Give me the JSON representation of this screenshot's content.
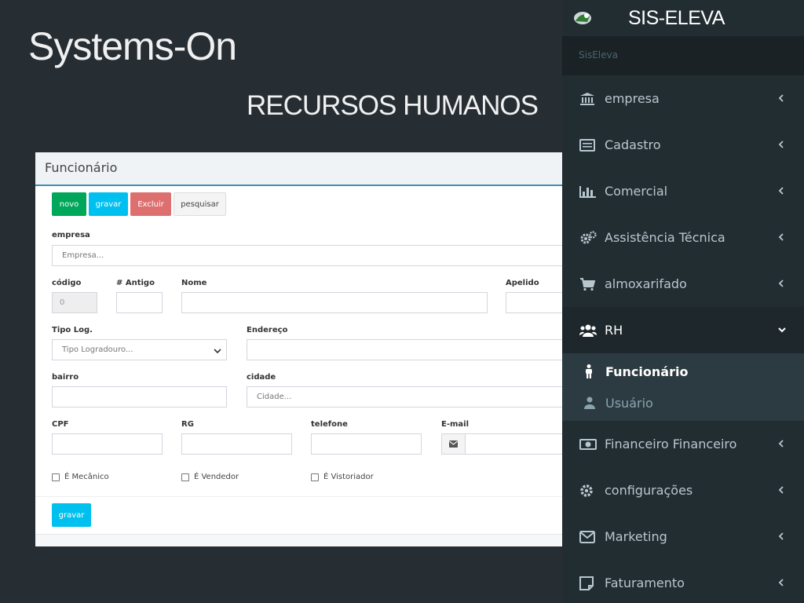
{
  "slide": {
    "title": "Systems-On",
    "subtitle": "RECURSOS HUMANOS"
  },
  "form": {
    "header": "Funcionário",
    "buttons": {
      "novo": "novo",
      "gravar": "gravar",
      "excluir": "Excluir",
      "pesquisar": "pesquisar"
    },
    "fields": {
      "empresa": {
        "label": "empresa",
        "placeholder": "Empresa..."
      },
      "codigo": {
        "label": "código",
        "value": "0"
      },
      "antigo": {
        "label": "# Antigo",
        "value": ""
      },
      "nome": {
        "label": "Nome",
        "value": ""
      },
      "apelido": {
        "label": "Apelido",
        "value": ""
      },
      "tipo_log": {
        "label": "Tipo Log.",
        "selected": "Tipo Logradouro..."
      },
      "endereco": {
        "label": "Endereço",
        "value": ""
      },
      "bairro": {
        "label": "bairro",
        "value": ""
      },
      "cidade": {
        "label": "cidade",
        "placeholder": "Cidade..."
      },
      "cpf": {
        "label": "CPF",
        "value": ""
      },
      "rg": {
        "label": "RG",
        "value": ""
      },
      "telefone": {
        "label": "telefone",
        "value": ""
      },
      "email": {
        "label": "E-mail",
        "value": ""
      }
    },
    "checkboxes": {
      "mecanico": "É Mecânico",
      "vendedor": "É Vendedor",
      "vistoriador": "É Vistoriador"
    },
    "footer_button": "gravar"
  },
  "sidebar": {
    "app_title": "SIS-ELEVA",
    "brand": "SisEleva",
    "items": [
      {
        "label": "empresa",
        "icon": "bank-icon"
      },
      {
        "label": "Cadastro",
        "icon": "list-icon"
      },
      {
        "label": "Comercial",
        "icon": "bar-chart-icon"
      },
      {
        "label": "Assistência Técnica",
        "icon": "gears-icon"
      },
      {
        "label": "almoxarifado",
        "icon": "cart-icon"
      },
      {
        "label": "RH",
        "icon": "users-icon",
        "expanded": true
      },
      {
        "label": "Financeiro Financeiro",
        "icon": "money-icon"
      },
      {
        "label": "configurações",
        "icon": "gear-icon"
      },
      {
        "label": "Marketing",
        "icon": "envelope-icon"
      },
      {
        "label": "Faturamento",
        "icon": "note-icon"
      }
    ],
    "rh_submenu": [
      {
        "label": "Funcionário",
        "icon": "male-icon",
        "active": true
      },
      {
        "label": "Usuário",
        "icon": "user-icon",
        "active": false
      }
    ]
  },
  "colors": {
    "background": "#262d33",
    "sidebar": "#222d32",
    "btn_success": "#00a65a",
    "btn_info": "#00c0ef",
    "btn_danger": "#dd6f6f",
    "accent": "#3c8dbc"
  }
}
